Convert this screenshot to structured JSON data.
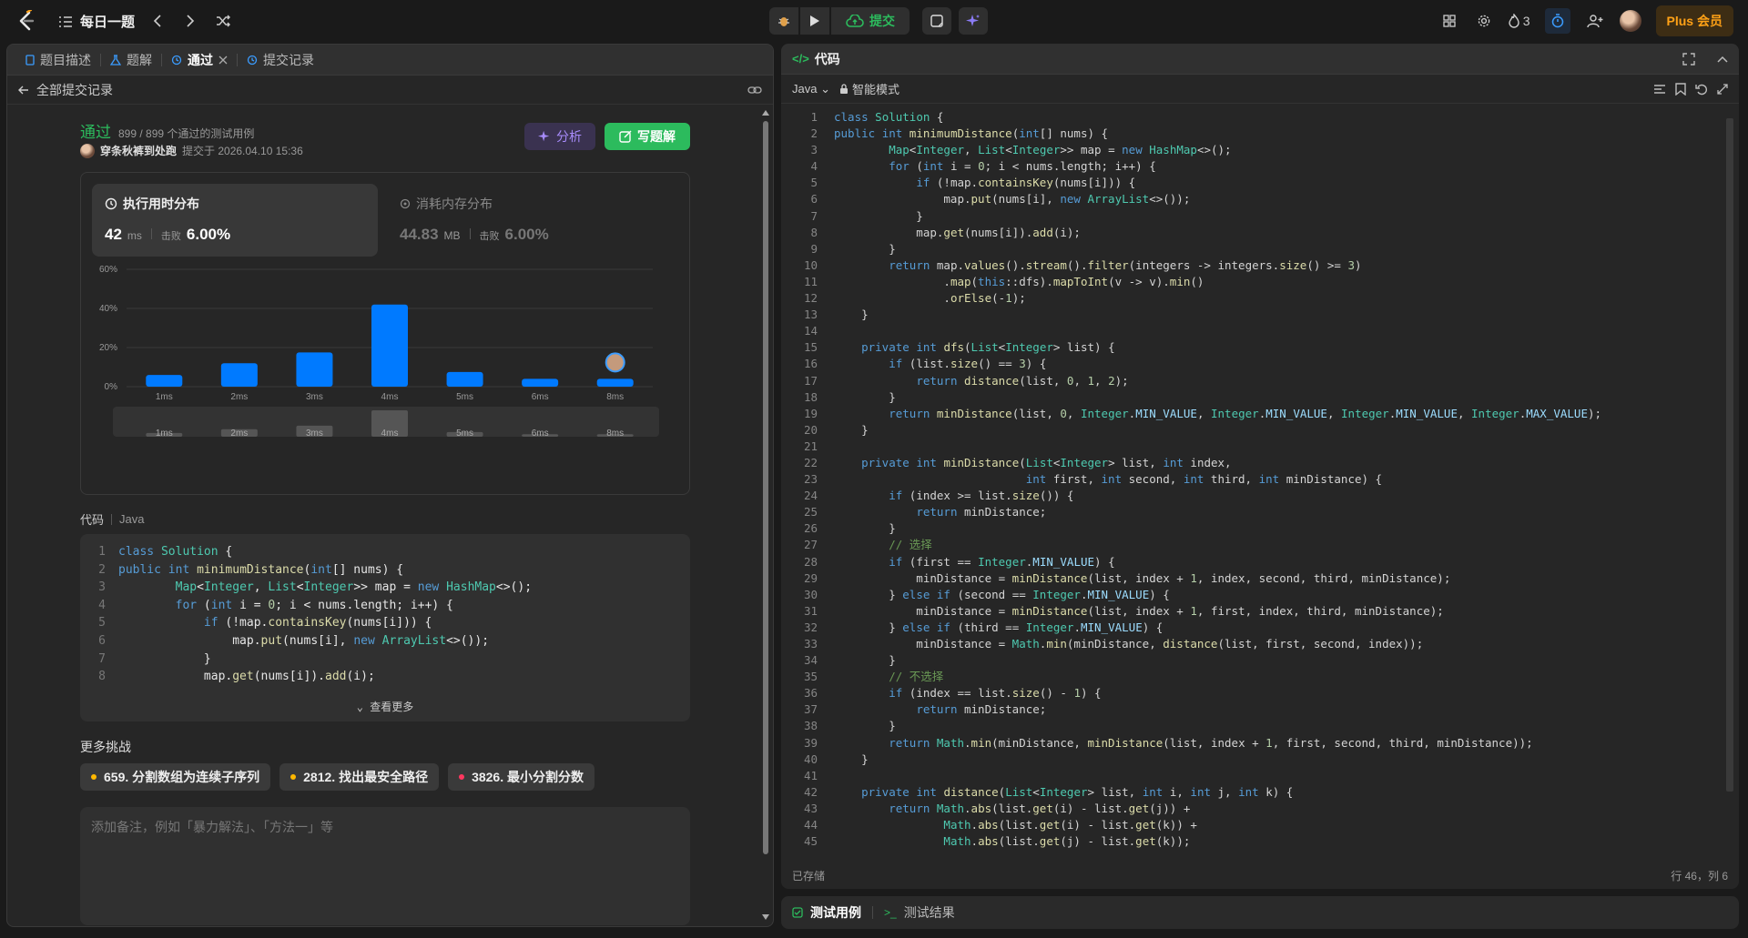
{
  "topbar": {
    "title": "每日一题",
    "submit_label": "提交",
    "streak_count": "3",
    "plus_label": "Plus 会员"
  },
  "left_tabs": [
    {
      "label": "题目描述"
    },
    {
      "label": "题解"
    },
    {
      "label": "通过"
    },
    {
      "label": "提交记录"
    }
  ],
  "subheader": {
    "back_label": "全部提交记录"
  },
  "submission": {
    "status": "通过",
    "tests": "899 / 899 个通过的测试用例",
    "user": "穿条秋裤到处跑",
    "submitted_at": "提交于 2026.04.10 15:36",
    "analyze_label": "分析",
    "write_label": "写题解"
  },
  "stats": {
    "runtime": {
      "title": "执行用时分布",
      "value": "42",
      "unit": "ms",
      "beat_label": "击败",
      "beat_pct": "6.00%"
    },
    "memory": {
      "title": "消耗内存分布",
      "value": "44.83",
      "unit": "MB",
      "beat_label": "击败",
      "beat_pct": "6.00%"
    }
  },
  "chart_data": {
    "type": "bar",
    "categories": [
      "1ms",
      "2ms",
      "3ms",
      "4ms",
      "5ms",
      "6ms",
      "8ms"
    ],
    "values": [
      6,
      12,
      17.5,
      42,
      7.5,
      4,
      4
    ],
    "yticks": [
      "0%",
      "20%",
      "40%",
      "60%"
    ],
    "ylim": [
      0,
      60
    ],
    "bar_color": "#007aff",
    "highlight_category": "8ms",
    "grid": true
  },
  "code_preview": {
    "label": "代码",
    "lang": "Java",
    "lines": [
      "class Solution {",
      "public int minimumDistance(int[] nums) {",
      "        Map<Integer, List<Integer>> map = new HashMap<>();",
      "        for (int i = 0; i < nums.length; i++) {",
      "            if (!map.containsKey(nums[i])) {",
      "                map.put(nums[i], new ArrayList<>());",
      "            }",
      "            map.get(nums[i]).add(i);"
    ],
    "view_more": "查看更多"
  },
  "more_challenges": {
    "title": "更多挑战",
    "items": [
      {
        "label": "659. 分割数组为连续子序列",
        "color": "#ffb800"
      },
      {
        "label": "2812. 找出最安全路径",
        "color": "#ffb800"
      },
      {
        "label": "3826. 最小分割分数",
        "color": "#ff375f"
      }
    ]
  },
  "notes": {
    "placeholder": "添加备注，例如「暴力解法」、「方法一」等"
  },
  "editor": {
    "title": "代码",
    "language": "Java",
    "mode": "智能模式",
    "saved": "已存储",
    "cursor": "行 46，列 6",
    "lines": [
      "class Solution {",
      "public int minimumDistance(int[] nums) {",
      "        Map<Integer, List<Integer>> map = new HashMap<>();",
      "        for (int i = 0; i < nums.length; i++) {",
      "            if (!map.containsKey(nums[i])) {",
      "                map.put(nums[i], new ArrayList<>());",
      "            }",
      "            map.get(nums[i]).add(i);",
      "        }",
      "        return map.values().stream().filter(integers -> integers.size() >= 3)",
      "                .map(this::dfs).mapToInt(v -> v).min()",
      "                .orElse(-1);",
      "    }",
      "",
      "    private int dfs(List<Integer> list) {",
      "        if (list.size() == 3) {",
      "            return distance(list, 0, 1, 2);",
      "        }",
      "        return minDistance(list, 0, Integer.MIN_VALUE, Integer.MIN_VALUE, Integer.MIN_VALUE, Integer.MAX_VALUE);",
      "    }",
      "",
      "    private int minDistance(List<Integer> list, int index,",
      "                            int first, int second, int third, int minDistance) {",
      "        if (index >= list.size()) {",
      "            return minDistance;",
      "        }",
      "        // 选择",
      "        if (first == Integer.MIN_VALUE) {",
      "            minDistance = minDistance(list, index + 1, index, second, third, minDistance);",
      "        } else if (second == Integer.MIN_VALUE) {",
      "            minDistance = minDistance(list, index + 1, first, index, third, minDistance);",
      "        } else if (third == Integer.MIN_VALUE) {",
      "            minDistance = Math.min(minDistance, distance(list, first, second, index));",
      "        }",
      "        // 不选择",
      "        if (index == list.size() - 1) {",
      "            return minDistance;",
      "        }",
      "        return Math.min(minDistance, minDistance(list, index + 1, first, second, third, minDistance));",
      "    }",
      "",
      "    private int distance(List<Integer> list, int i, int j, int k) {",
      "        return Math.abs(list.get(i) - list.get(j)) +",
      "                Math.abs(list.get(i) - list.get(k)) +",
      "                Math.abs(list.get(j) - list.get(k));"
    ]
  },
  "bottom_tabs": [
    {
      "label": "测试用例"
    },
    {
      "label": "测试结果"
    }
  ]
}
